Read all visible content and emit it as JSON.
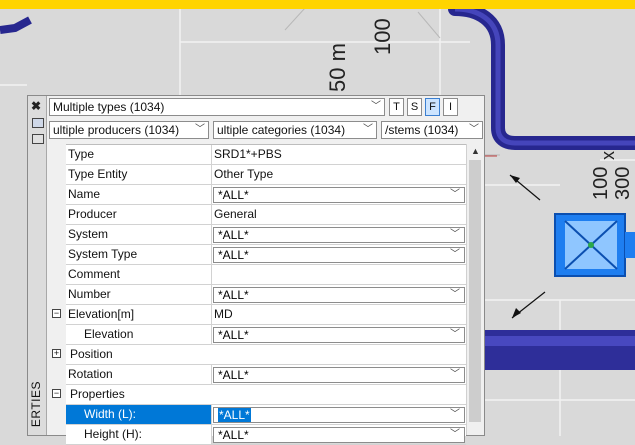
{
  "drawing": {
    "labels": {
      "dim_50": "50 m",
      "dim_100_top": "100",
      "dim_100_right": "100",
      "dim_300": "300",
      "dim_x": "x"
    },
    "colors": {
      "pipe": "#3a3aa8",
      "equipment": "#2b8cf0",
      "bar": "#ffd400"
    }
  },
  "palette": {
    "side_title": "ERTIES",
    "type_select": "Multiple types (1034)",
    "toggles": [
      "T",
      "S",
      "F",
      "I"
    ],
    "active_toggle": "F",
    "producers_select": "ultiple producers (1034)",
    "categories_select": "ultiple categories (1034)",
    "systems_select": "/stems (1034)",
    "rows": [
      {
        "label": "Type",
        "value": "SRD1*+PBS"
      },
      {
        "label": "Type Entity",
        "value": "Other Type"
      },
      {
        "label": "Name",
        "value": "*ALL*"
      },
      {
        "label": "Producer",
        "value": "General"
      },
      {
        "label": "System",
        "value": "*ALL*"
      },
      {
        "label": "System Type",
        "value": "*ALL*"
      },
      {
        "label": "Comment",
        "value": ""
      },
      {
        "label": "Number",
        "value": "*ALL*"
      },
      {
        "label": "Elevation[m]",
        "value": "MD"
      },
      {
        "label": "Elevation",
        "value": "*ALL*"
      },
      {
        "label": "Position",
        "value": ""
      },
      {
        "label": "Rotation",
        "value": "*ALL*"
      },
      {
        "label": "Properties",
        "value": ""
      },
      {
        "label": "Width (L):",
        "value": "*ALL*"
      },
      {
        "label": "Height (H):",
        "value": "*ALL*"
      }
    ]
  }
}
